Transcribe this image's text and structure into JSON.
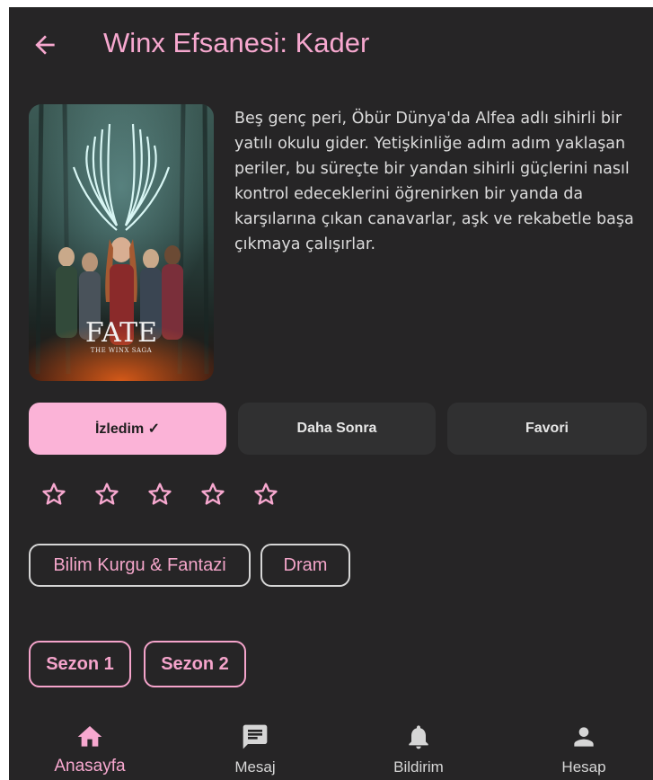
{
  "app_bar": {
    "back_icon": "arrow-left-icon",
    "title": "Winx Efsanesi: Kader"
  },
  "poster": {
    "title_text": "FATE",
    "subtitle_text": "THE WINX SAGA"
  },
  "description": "Beş genç peri, Öbür Dünya'da Alfea adlı sihirli bir yatılı okulu gider. Yetişkinliğe adım adım yaklaşan periler, bu süreçte bir yandan sihirli güçlerini nasıl kontrol edeceklerini öğrenirken bir yanda da karşılarına çıkan canavarlar, aşk ve rekabetle başa çıkmaya çalışırlar.",
  "status_buttons": [
    {
      "label": "İzledim ✓",
      "active": true
    },
    {
      "label": "Daha Sonra",
      "active": false
    },
    {
      "label": "Favori",
      "active": false
    }
  ],
  "rating": {
    "value": 0,
    "max": 5,
    "icon": "star-outline-icon"
  },
  "genres": [
    "Bilim Kurgu & Fantazi",
    "Dram"
  ],
  "seasons": [
    "Sezon 1",
    "Sezon 2"
  ],
  "bottom_nav": [
    {
      "label": "Anasayfa",
      "icon": "home-icon",
      "active": true
    },
    {
      "label": "Mesaj",
      "icon": "message-icon",
      "active": false
    },
    {
      "label": "Bildirim",
      "icon": "bell-icon",
      "active": false
    },
    {
      "label": "Hesap",
      "icon": "person-icon",
      "active": false
    }
  ],
  "colors": {
    "accent": "#f7a8cf",
    "background": "#262526",
    "button_inactive": "#303031",
    "button_active": "#fbb3d7"
  }
}
